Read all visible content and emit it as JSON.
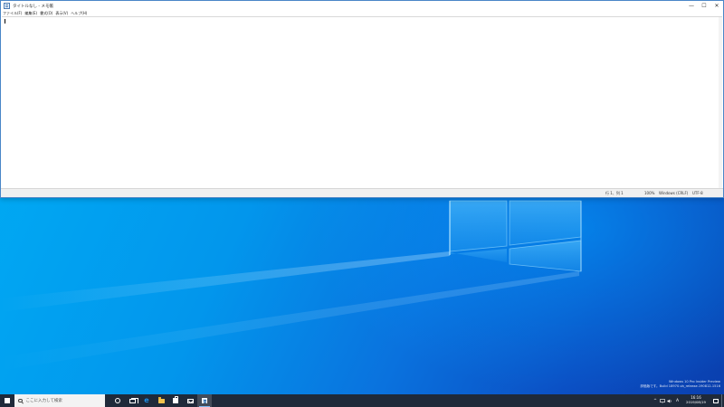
{
  "notepad": {
    "title": "タイトルなし - メモ帳",
    "menu": [
      {
        "label": "ファイル(F)"
      },
      {
        "label": "編集(E)"
      },
      {
        "label": "書式(O)"
      },
      {
        "label": "表示(V)"
      },
      {
        "label": "ヘルプ(H)"
      }
    ],
    "controls": {
      "minimize": "—",
      "maximize": "☐",
      "close": "✕"
    },
    "editor_text": "",
    "status": {
      "position": "行 1、列 1",
      "zoom": "100%",
      "line_ending": "Windows (CRLF)",
      "encoding": "UTF-8"
    }
  },
  "desktop": {
    "watermark_line1": "Windows 10 Pro Insider Preview",
    "watermark_line2": "評価版です。Build 18970.vb_release.190812-1516"
  },
  "taskbar": {
    "search_placeholder": "ここに入力して検索",
    "tray": {
      "chevron": "^",
      "ime": "A",
      "time": "16:16",
      "date": "2019/08/19"
    }
  },
  "colors": {
    "accent": "#0078d7",
    "taskbar": "#1f2a3a",
    "wallpaper_light": "#00aef5",
    "wallpaper_dark": "#0a3fae"
  }
}
